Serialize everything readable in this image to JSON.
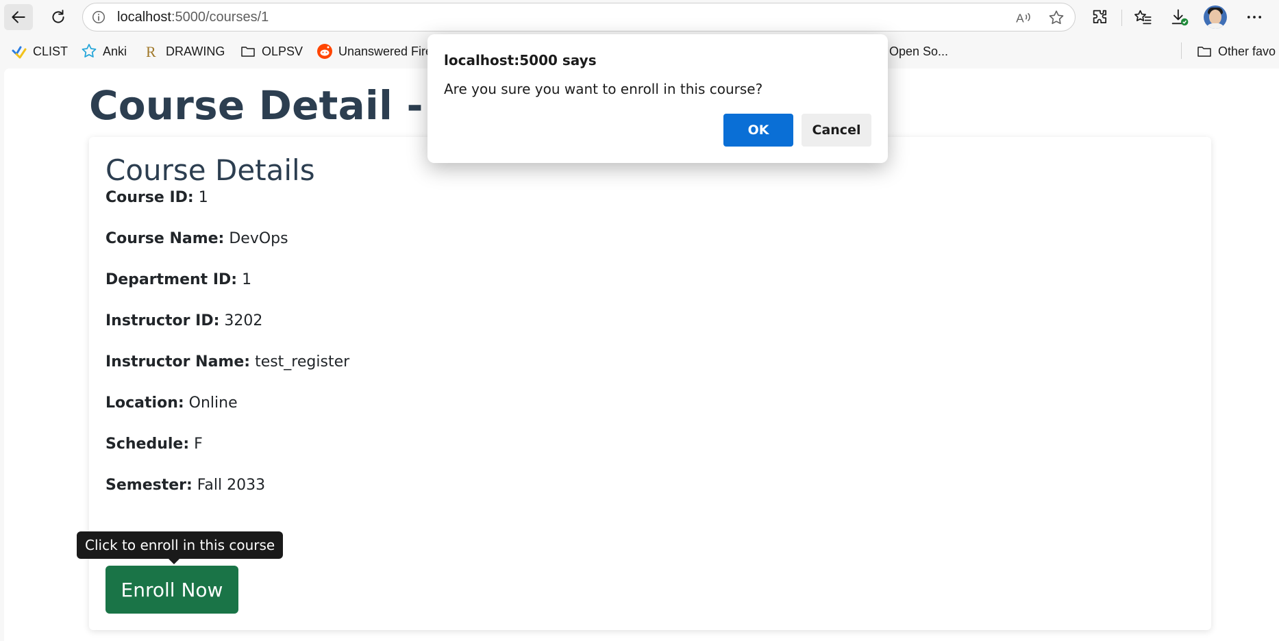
{
  "browser": {
    "url_host": "localhost",
    "url_path": ":5000/courses/1",
    "icons": [
      "back-arrow-icon",
      "reload-icon",
      "site-info-icon",
      "read-aloud-icon",
      "favorite-star-icon",
      "extensions-icon",
      "favorites-icon",
      "downloads-icon",
      "profile-avatar",
      "more-options-icon"
    ]
  },
  "favorites": [
    {
      "label": "CLIST",
      "icon": "clist-icon"
    },
    {
      "label": "Anki",
      "icon": "anki-star-icon"
    },
    {
      "label": "DRAWING",
      "icon": "r-logo-icon"
    },
    {
      "label": "OLPSV",
      "icon": "folder-icon"
    },
    {
      "label": "Unanswered Fire",
      "icon": "reddit-icon"
    },
    {
      "label": "Open So...",
      "icon": ""
    },
    {
      "label": "Other favo",
      "icon": "folder-icon"
    }
  ],
  "page": {
    "title": "Course Detail - De",
    "card_title": "Course Details",
    "fields": [
      {
        "label": "Course ID:",
        "value": "1"
      },
      {
        "label": "Course Name:",
        "value": "DevOps"
      },
      {
        "label": "Department ID:",
        "value": "1"
      },
      {
        "label": "Instructor ID:",
        "value": "3202"
      },
      {
        "label": "Instructor Name:",
        "value": "test_register"
      },
      {
        "label": "Location:",
        "value": "Online"
      },
      {
        "label": "Schedule:",
        "value": "F"
      },
      {
        "label": "Semester:",
        "value": "Fall 2033"
      }
    ],
    "enroll_label": "Enroll Now",
    "tooltip": "Click to enroll in this course"
  },
  "dialog": {
    "title": "localhost:5000 says",
    "message": "Are you sure you want to enroll in this course?",
    "ok_label": "OK",
    "cancel_label": "Cancel"
  },
  "colors": {
    "heading": "#2c3e50",
    "enroll_button": "#1a7447",
    "ok_button": "#0a6fd6",
    "tooltip_bg": "#1a1a1a"
  }
}
